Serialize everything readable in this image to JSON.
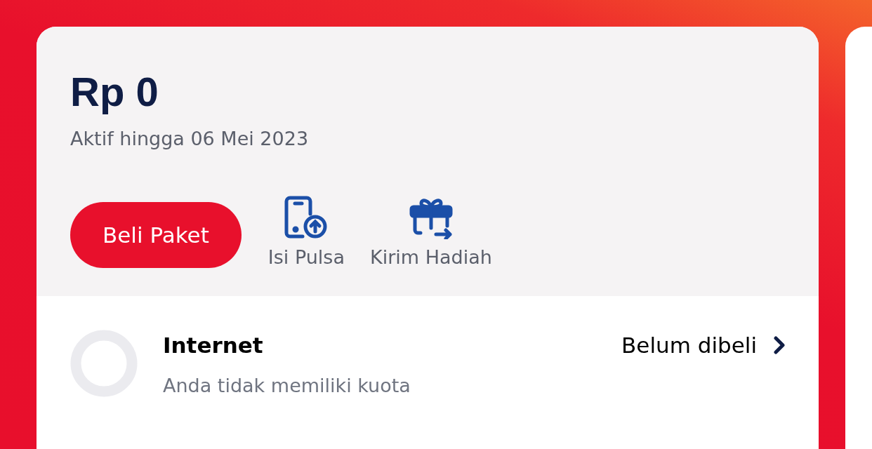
{
  "balance": {
    "amount": "Rp 0",
    "validity": "Aktif hingga 06 Mei 2023"
  },
  "primary_button": "Beli Paket",
  "actions": [
    {
      "kind": "topup",
      "label": "Isi Pulsa"
    },
    {
      "kind": "gift",
      "label": "Kirim Hadiah"
    }
  ],
  "quota": {
    "title": "Internet",
    "subtitle": "Anda tidak memiliki kuota",
    "status": "Belum dibeli"
  }
}
